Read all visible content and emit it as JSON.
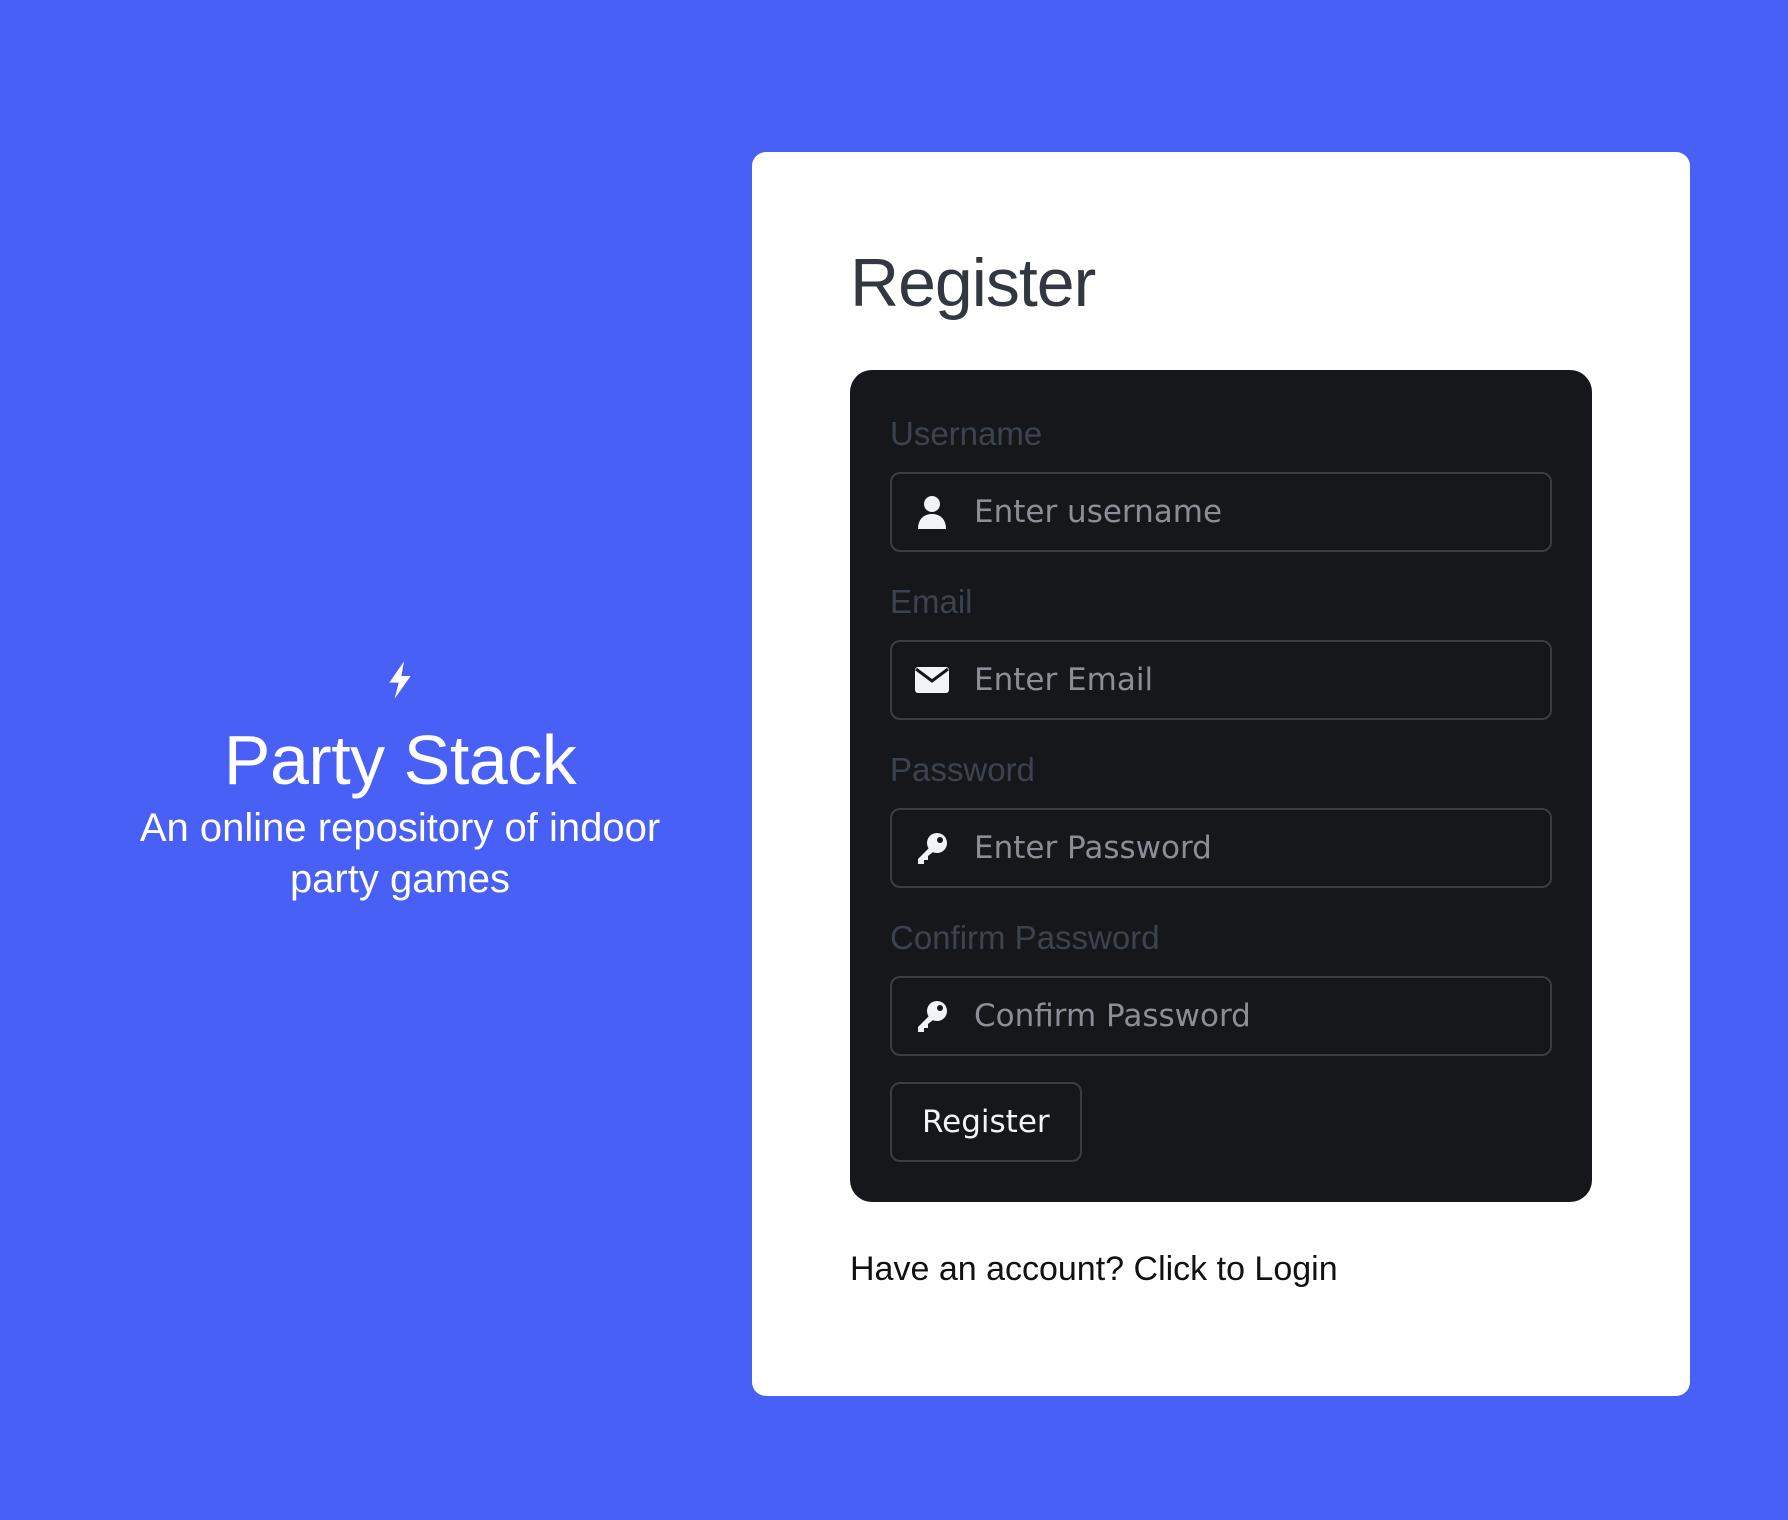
{
  "brand": {
    "icon": "lightning-bolt-icon",
    "name": "Party Stack",
    "tagline": "An online repository of indoor party games"
  },
  "register": {
    "title": "Register",
    "fields": [
      {
        "label": "Username",
        "placeholder": "Enter username",
        "icon": "user-icon",
        "type": "text"
      },
      {
        "label": "Email",
        "placeholder": "Enter Email",
        "icon": "envelope-icon",
        "type": "email"
      },
      {
        "label": "Password",
        "placeholder": "Enter Password",
        "icon": "key-icon",
        "type": "password"
      },
      {
        "label": "Confirm Password",
        "placeholder": "Confirm Password",
        "icon": "key-icon",
        "type": "password"
      }
    ],
    "submit_label": "Register",
    "login_prompt": "Have an account? Click to Login"
  },
  "colors": {
    "background": "#4860f5",
    "card": "#ffffff",
    "form_panel": "#16171b",
    "label": "#3c4350",
    "title": "#323741"
  }
}
